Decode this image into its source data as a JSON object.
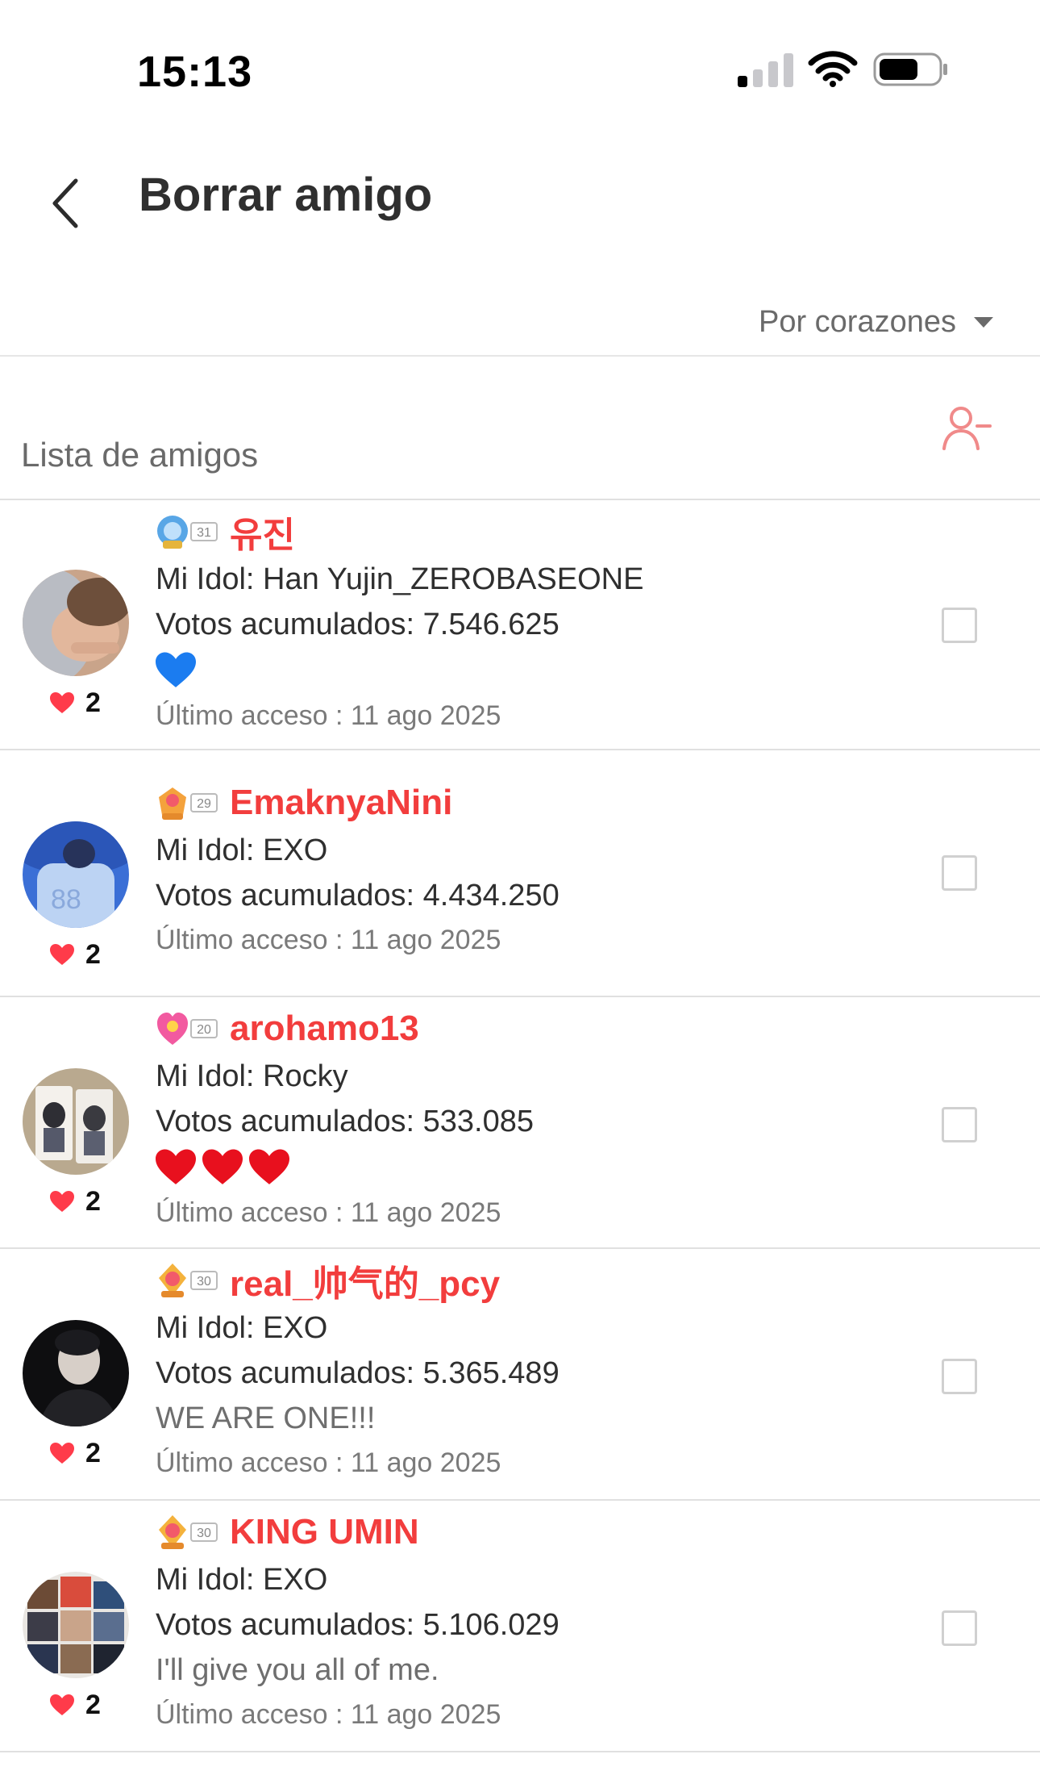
{
  "status_bar": {
    "time": "15:13"
  },
  "header": {
    "title": "Borrar amigo",
    "back_icon": "chevron-left-icon"
  },
  "sort": {
    "selected": "Por corazones"
  },
  "section": {
    "title": "Lista de amigos",
    "remove_icon": "remove-user-icon"
  },
  "colors": {
    "name_red": "#f23d3d",
    "remove_icon": "#f08a8a",
    "heart": "#ff3b4a"
  },
  "friends": [
    {
      "name": "유진",
      "level": "31",
      "idol": "Mi Idol: Han Yujin_ZEROBASEONE",
      "votes": "Votos acumulados: 7.546.625",
      "status_emoji": [
        "blue-heart"
      ],
      "last_seen": "Último acceso : 11 ago 2025",
      "hearts": "2"
    },
    {
      "name": "EmaknyaNini",
      "level": "29",
      "idol": "Mi Idol: EXO",
      "votes": "Votos acumulados: 4.434.250",
      "last_seen": "Último acceso : 11 ago 2025",
      "hearts": "2"
    },
    {
      "name": "arohamo13",
      "level": "20",
      "idol": "Mi Idol: Rocky",
      "votes": "Votos acumulados: 533.085",
      "status_emoji": [
        "red-heart",
        "red-heart",
        "red-heart"
      ],
      "last_seen": "Último acceso : 11 ago 2025",
      "hearts": "2"
    },
    {
      "name": "real_帅气的_pcy",
      "level": "30",
      "idol": "Mi Idol: EXO",
      "votes": "Votos acumulados: 5.365.489",
      "status_text": "WE ARE ONE!!!",
      "last_seen": "Último acceso : 11 ago 2025",
      "hearts": "2"
    },
    {
      "name": "KING UMIN",
      "level": "30",
      "idol": "Mi Idol: EXO",
      "votes": "Votos acumulados: 5.106.029",
      "status_text": "I'll give you all of me.",
      "last_seen": "Último acceso : 11 ago 2025",
      "hearts": "2"
    }
  ]
}
